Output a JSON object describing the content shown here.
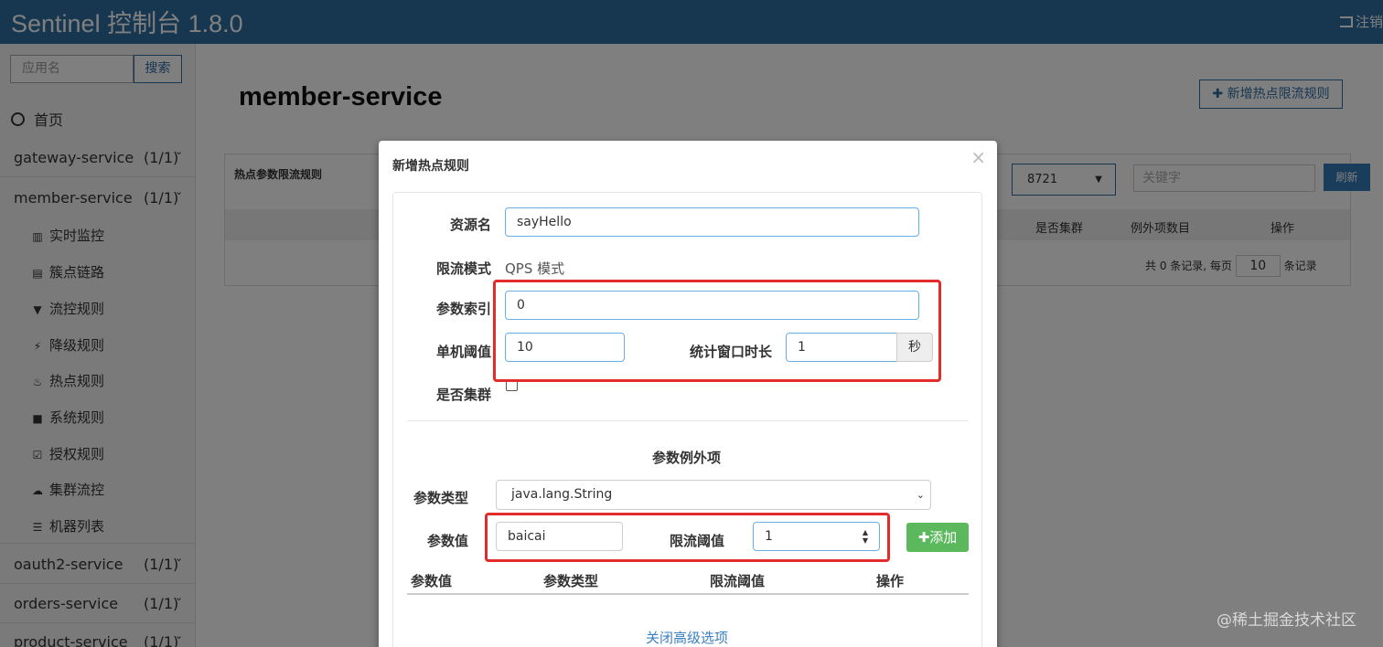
{
  "app": {
    "title": "Sentinel 控制台 1.8.0",
    "logout": "注销"
  },
  "sidebar": {
    "search_placeholder": "应用名",
    "search_button": "搜索",
    "home": "首页",
    "services": [
      {
        "name": "gateway-service",
        "count": "(1/1)"
      },
      {
        "name": "member-service",
        "count": "(1/1)"
      },
      {
        "name": "oauth2-service",
        "count": "(1/1)"
      },
      {
        "name": "orders-service",
        "count": "(1/1)"
      },
      {
        "name": "product-service",
        "count": "(1/1)"
      }
    ],
    "sub_items": [
      {
        "label": "实时监控",
        "icon": "bar-chart-icon"
      },
      {
        "label": "簇点链路",
        "icon": "list-icon"
      },
      {
        "label": "流控规则",
        "icon": "filter-icon"
      },
      {
        "label": "降级规则",
        "icon": "flash-icon"
      },
      {
        "label": "热点规则",
        "icon": "fire-icon"
      },
      {
        "label": "系统规则",
        "icon": "lock-icon"
      },
      {
        "label": "授权规则",
        "icon": "check-icon"
      },
      {
        "label": "集群流控",
        "icon": "cloud-icon"
      },
      {
        "label": "机器列表",
        "icon": "th-list-icon"
      }
    ]
  },
  "main": {
    "title": "member-service",
    "add_button": "新增热点限流规则",
    "panel_title": "热点参数限流规则",
    "machine_select": "8721",
    "keyword_placeholder": "关键字",
    "refresh": "刷新",
    "columns": [
      "是否集群",
      "例外项数目",
      "操作"
    ],
    "pager_prefix": "共 0 条记录, 每页",
    "page_size": "10",
    "pager_suffix": "条记录"
  },
  "modal": {
    "title": "新增热点规则",
    "close": "×",
    "resource_label": "资源名",
    "resource_value": "sayHello",
    "mode_label": "限流模式",
    "mode_value": "QPS 模式",
    "param_index_label": "参数索引",
    "param_index_value": "0",
    "threshold_label": "单机阈值",
    "threshold_value": "10",
    "window_label": "统计窗口时长",
    "window_value": "1",
    "window_unit": "秒",
    "cluster_label": "是否集群",
    "exception_title": "参数例外项",
    "param_type_label": "参数类型",
    "param_type_value": "java.lang.String",
    "param_value_label": "参数值",
    "param_value_value": "baicai",
    "limit_threshold_label": "限流阈值",
    "limit_threshold_value": "1",
    "add_button": "添加",
    "table_headers": [
      "参数值",
      "参数类型",
      "限流阈值",
      "操作"
    ],
    "close_advanced": "关闭高级选项"
  },
  "watermark": "@稀土掘金技术社区"
}
